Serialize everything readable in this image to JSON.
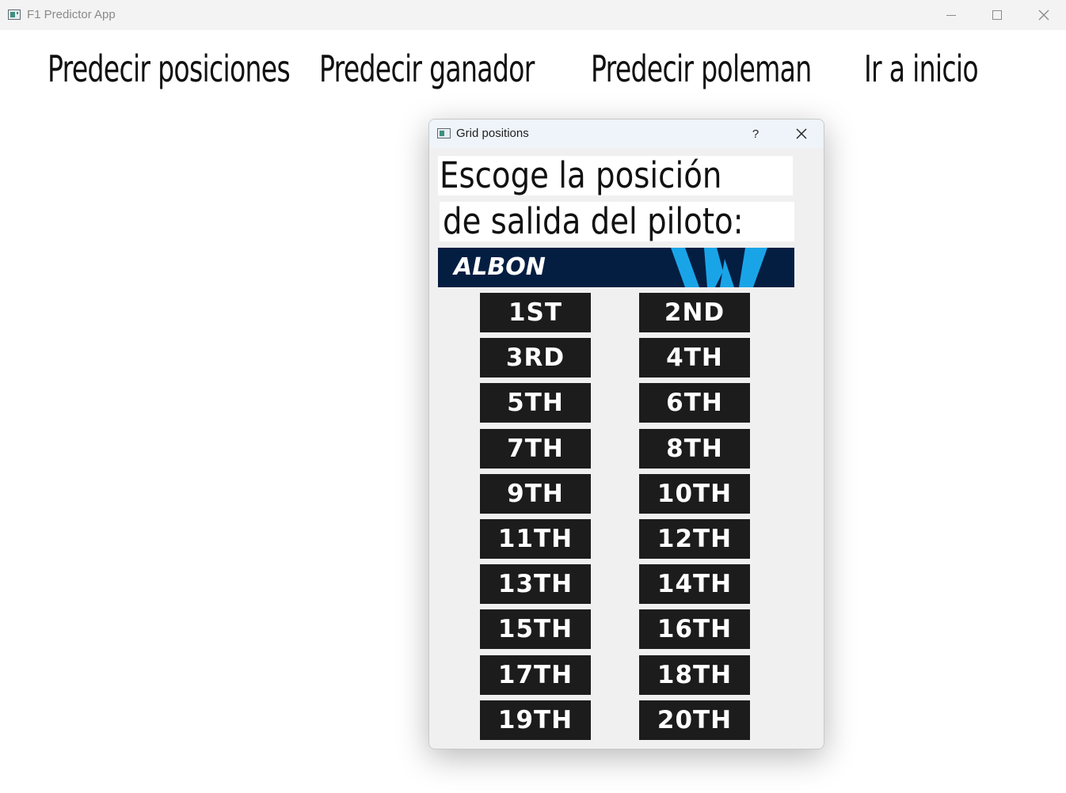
{
  "window": {
    "title": "F1 Predictor App"
  },
  "nav": {
    "items": [
      "Predecir posiciones",
      "Predecir ganador",
      "Predecir poleman",
      "Ir a inicio"
    ]
  },
  "dialog": {
    "title": "Grid positions",
    "help_label": "?",
    "prompt_line1": "Escoge la posición",
    "prompt_line2": "de salida del piloto:",
    "driver_name": "ALBON",
    "banner_color": "#041e42",
    "logo_color": "#1aa4e8",
    "positions": [
      "1ST",
      "2ND",
      "3RD",
      "4TH",
      "5TH",
      "6TH",
      "7TH",
      "8TH",
      "9TH",
      "10TH",
      "11TH",
      "12TH",
      "13TH",
      "14TH",
      "15TH",
      "16TH",
      "17TH",
      "18TH",
      "19TH",
      "20TH"
    ]
  }
}
